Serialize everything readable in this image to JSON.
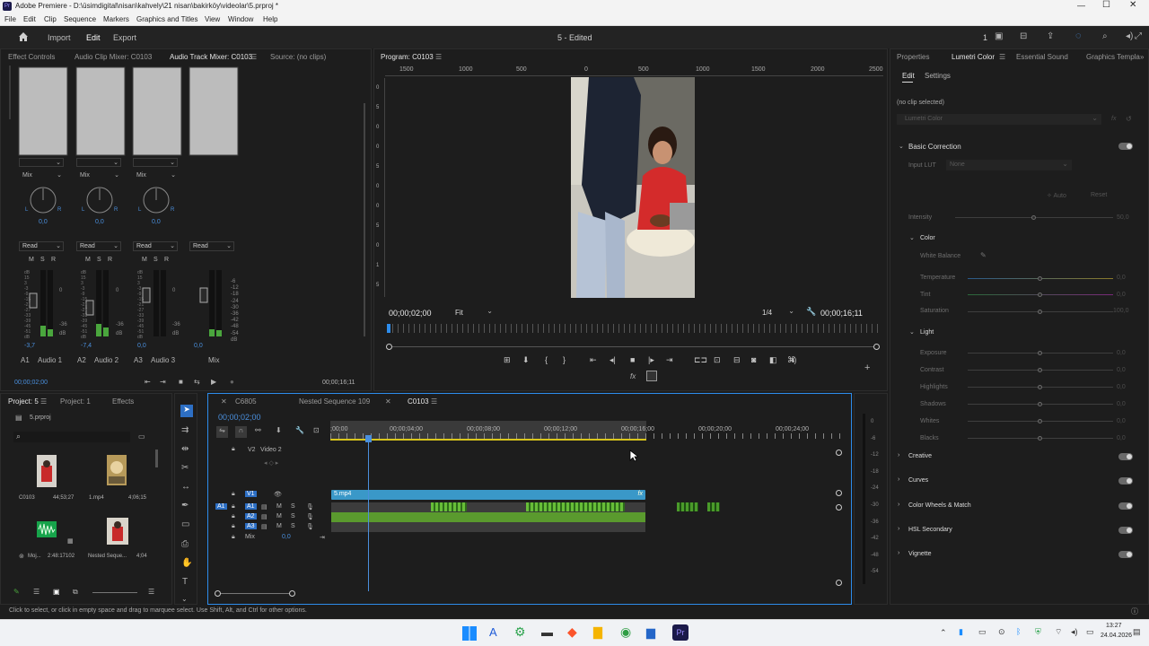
{
  "window": {
    "title": "Adobe Premiere - D:\\ūsimdigital\\nisan\\kahvely\\21 nisan\\bakirköy\\videolar\\5.prproj *"
  },
  "menu": [
    "File",
    "Edit",
    "Clip",
    "Sequence",
    "Markers",
    "Graphics and Titles",
    "View",
    "Window",
    "Help"
  ],
  "header": {
    "import": "Import",
    "edit": "Edit",
    "export": "Export",
    "doc_title": "5 - Edited",
    "counter": "1"
  },
  "effect_panel_tabs": [
    "Effect Controls",
    "Audio Clip Mixer: C0103",
    "Audio Track Mixer: C0103",
    "Source: (no clips)"
  ],
  "mixer": {
    "channels": [
      {
        "mode": "Mix",
        "pan": "0,0",
        "automation": "Read",
        "volume": "-3,7",
        "code": "A1",
        "name": "Audio 1"
      },
      {
        "mode": "Mix",
        "pan": "0,0",
        "automation": "Read",
        "volume": "-7,4",
        "code": "A2",
        "name": "Audio 2"
      },
      {
        "mode": "Mix",
        "pan": "0,0",
        "automation": "Read",
        "volume": "0,0",
        "code": "A3",
        "name": "Audio 3"
      },
      {
        "automation": "Read",
        "volume": "0,0",
        "name": "Mix"
      }
    ],
    "db_scale": [
      "dB",
      "15",
      "3",
      "-3",
      "-9",
      "-15",
      "-21",
      "-27",
      "-33",
      "-39",
      "-45",
      "-51",
      "dB"
    ],
    "db_right": [
      "0",
      "-36",
      "dB"
    ],
    "db_mix": [
      "-6",
      "-12",
      "-18",
      "-24",
      "-30",
      "-36",
      "-42",
      "-48",
      "-54",
      "dB"
    ],
    "msr": [
      "M",
      "S",
      "R"
    ],
    "timecode_left": "00;00;02;00",
    "timecode_right": "00;00;16;11"
  },
  "program": {
    "tab": "Program: C0103",
    "ruler": [
      "1500",
      "1000",
      "500",
      "0",
      "500",
      "1000",
      "1500",
      "2000",
      "2500"
    ],
    "vruler": [
      "0",
      "5",
      "0",
      "0",
      "5",
      "0",
      "0",
      "5",
      "0",
      "1",
      "5"
    ],
    "timecode": "00;00;02;00",
    "zoom": "Fit",
    "resolution": "1/4",
    "duration": "00;00;16;11"
  },
  "right_tabs": [
    "Properties",
    "Lumetri Color",
    "Essential Sound",
    "Graphics Templa"
  ],
  "lumetri": {
    "subtabs": [
      "Edit",
      "Settings"
    ],
    "clip": "(no clip selected)",
    "effect": "Lumetri Color",
    "basic": "Basic Correction",
    "input_lut_label": "Input LUT",
    "input_lut_value": "None",
    "auto": "Auto",
    "reset": "Reset",
    "intensity": {
      "label": "Intensity",
      "value": "50,0"
    },
    "color_section": "Color",
    "white_balance": "White Balance",
    "color_rows": [
      {
        "label": "Temperature",
        "value": "0,0"
      },
      {
        "label": "Tint",
        "value": "0,0"
      },
      {
        "label": "Saturation",
        "value": "100,0"
      }
    ],
    "light_section": "Light",
    "light_rows": [
      {
        "label": "Exposure",
        "value": "0,0"
      },
      {
        "label": "Contrast",
        "value": "0,0"
      },
      {
        "label": "Highlights",
        "value": "0,0"
      },
      {
        "label": "Shadows",
        "value": "0,0"
      },
      {
        "label": "Whites",
        "value": "0,0"
      },
      {
        "label": "Blacks",
        "value": "0,0"
      }
    ],
    "collapsed_sections": [
      "Creative",
      "Curves",
      "Color Wheels & Match",
      "HSL Secondary",
      "Vignette"
    ]
  },
  "project": {
    "tabs": [
      "Project: 5",
      "Project: 1",
      "Effects"
    ],
    "file": "5.prproj",
    "items": [
      {
        "name": "C0103",
        "duration": "44;53;27"
      },
      {
        "name": "1.mp4",
        "duration": "4;06;15"
      },
      {
        "name": "Moj...",
        "duration": "2:48:17102"
      },
      {
        "name": "Nested Seque...",
        "duration": "4;04"
      }
    ]
  },
  "timeline": {
    "tabs": [
      "C6805",
      "Nested Sequence 109",
      "C0103"
    ],
    "timecode": "00;00;02;00",
    "ruler": [
      ";00;00",
      "00;00;04;00",
      "00;00;08;00",
      "00;00;12;00",
      "00;00;16;00",
      "00;00;20;00",
      "00;00;24;00"
    ],
    "tracks": {
      "v2": "V2",
      "v2_name": "Video 2",
      "v1": "V1",
      "a1_src": "A1",
      "a1": "A1",
      "a2": "A2",
      "a3": "A3",
      "mix": "Mix",
      "mix_val": "0,0"
    },
    "clip_name": "5.mp4",
    "meter_scale": [
      "0",
      "-6",
      "-12",
      "-18",
      "-24",
      "-30",
      "-36",
      "-42",
      "-48",
      "-54"
    ]
  },
  "status": "Click to select, or click in empty space and drag to marquee select. Use Shift, Alt, and Ctrl for other options.",
  "taskbar": {
    "time": "13:27",
    "date": "24.04.2026"
  }
}
